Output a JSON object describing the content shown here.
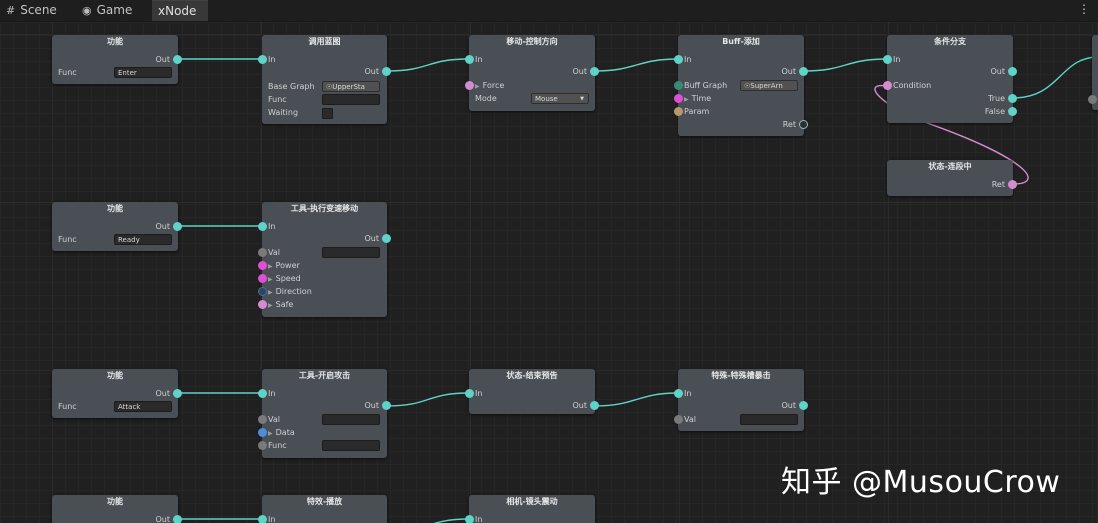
{
  "tabs": [
    {
      "label": "Scene",
      "icon": "grid-icon"
    },
    {
      "label": "Game",
      "icon": "gamepad-icon"
    },
    {
      "label": "xNode",
      "icon": ""
    }
  ],
  "menu_glyph": "⋮",
  "nodes": {
    "func1": {
      "title": "功能",
      "out": "Out",
      "func_label": "Func",
      "func_value": "Enter"
    },
    "call_bp": {
      "title": "调用蓝图",
      "in": "In",
      "out": "Out",
      "base_graph_label": "Base Graph",
      "base_graph_value": "UpperSta",
      "func_label": "Func",
      "waiting_label": "Waiting"
    },
    "move_dir": {
      "title": "移动-控制方向",
      "in": "In",
      "out": "Out",
      "force_label": "Force",
      "mode_label": "Mode",
      "mode_value": "Mouse"
    },
    "buff_add": {
      "title": "Buff-添加",
      "in": "In",
      "out": "Out",
      "buff_graph_label": "Buff Graph",
      "buff_graph_value": "SuperArn",
      "time_label": "Time",
      "param_label": "Param",
      "ret_label": "Ret"
    },
    "branch": {
      "title": "条件分支",
      "in": "In",
      "out": "Out",
      "condition_label": "Condition",
      "true_label": "True",
      "false_label": "False"
    },
    "combo_state": {
      "title": "状态-连段中",
      "ret_label": "Ret"
    },
    "func2": {
      "title": "功能",
      "out": "Out",
      "func_label": "Func",
      "func_value": "Ready"
    },
    "tool_move": {
      "title": "工具-执行变速移动",
      "in": "In",
      "out": "Out",
      "val_label": "Val",
      "power_label": "Power",
      "speed_label": "Speed",
      "direction_label": "Direction",
      "safe_label": "Safe"
    },
    "func3": {
      "title": "功能",
      "out": "Out",
      "func_label": "Func",
      "func_value": "Attack"
    },
    "tool_attack": {
      "title": "工具-开启攻击",
      "in": "In",
      "out": "Out",
      "val_label": "Val",
      "data_label": "Data",
      "func_label": "Func"
    },
    "end_state": {
      "title": "状态-结束预告",
      "in": "In",
      "out": "Out"
    },
    "special": {
      "title": "特殊-特殊槽暴击",
      "in": "In",
      "out": "Out",
      "val_label": "Val"
    },
    "func4": {
      "title": "功能",
      "out": "Out"
    },
    "fx_play": {
      "title": "特效-播放",
      "in": "In"
    },
    "cam_shake": {
      "title": "相机-镜头震动",
      "in": "In"
    }
  },
  "watermark": "知乎 @MusouCrow",
  "colors": {
    "port_flow": "#5fd3c8",
    "wire_flow": "#5fd3c8",
    "wire_bool": "#d58bd0",
    "node_body": "#4a4f55"
  }
}
